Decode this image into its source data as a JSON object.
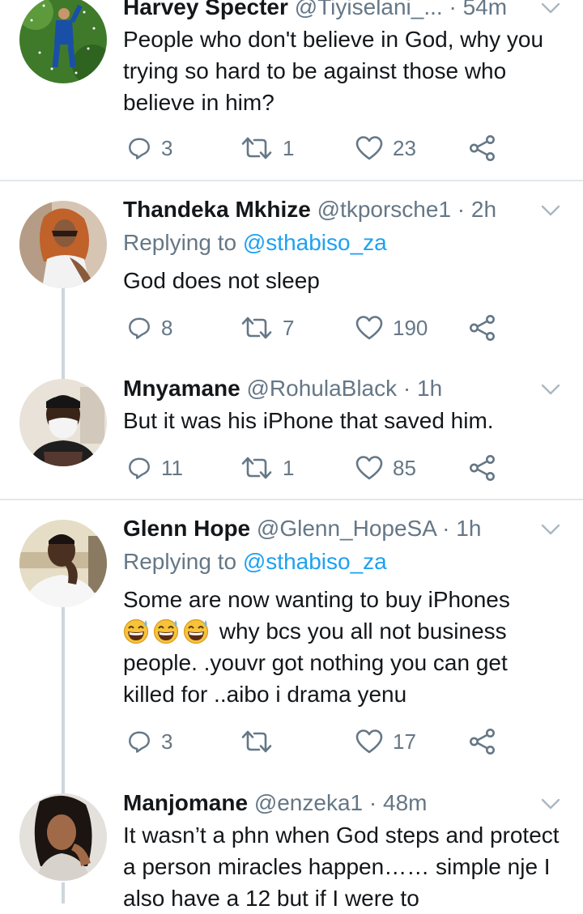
{
  "tweets": [
    {
      "name": "Harvey Specter",
      "handle": "@Tiyiselani_...",
      "dot": "·",
      "time": "54m",
      "replying_label": "",
      "replying_mention": "",
      "text": "People who don't believe in God, why you trying so hard to be against those who believe in him?",
      "replies": "3",
      "retweets": "1",
      "likes": "23"
    },
    {
      "name": "Thandeka Mkhize",
      "handle": "@tkporsche1",
      "dot": "·",
      "time": "2h",
      "replying_label": "Replying to",
      "replying_mention": "@sthabiso_za",
      "text": "God does not sleep",
      "replies": "8",
      "retweets": "7",
      "likes": "190"
    },
    {
      "name": "Mnyamane",
      "handle": "@RohulaBlack",
      "dot": "·",
      "time": "1h",
      "text": "But it was his iPhone that saved him.",
      "replies": "11",
      "retweets": "1",
      "likes": "85"
    },
    {
      "name": "Glenn Hope",
      "handle": "@Glenn_HopeSA",
      "dot": "·",
      "time": "1h",
      "replying_label": "Replying to",
      "replying_mention": "@sthabiso_za",
      "text_line1": "Some are now wanting to buy iPhones",
      "text_after_emoji": "why bcs you all not business",
      "text_rest": "people. .youvr got nothing you can get killed for ..aibo i drama yenu",
      "emoji": "grinning-sweat-emoji",
      "replies": "3",
      "retweets": "",
      "likes": "17"
    },
    {
      "name": "Manjomane",
      "handle": "@enzeka1",
      "dot": "·",
      "time": "48m",
      "text": "It wasn’t a phn when God steps and protect a person miracles happen…… simple nje I also have a 12 but if I were to"
    }
  ],
  "icons": {
    "reply": "reply-icon",
    "retweet": "retweet-icon",
    "like": "heart-icon",
    "share": "share-icon",
    "menu": "chevron-down-icon"
  },
  "colors": {
    "text": "#14171a",
    "muted": "#657786",
    "link": "#1da1f2",
    "divider": "#e1e8ed",
    "thread_line": "#ccd6dd"
  }
}
